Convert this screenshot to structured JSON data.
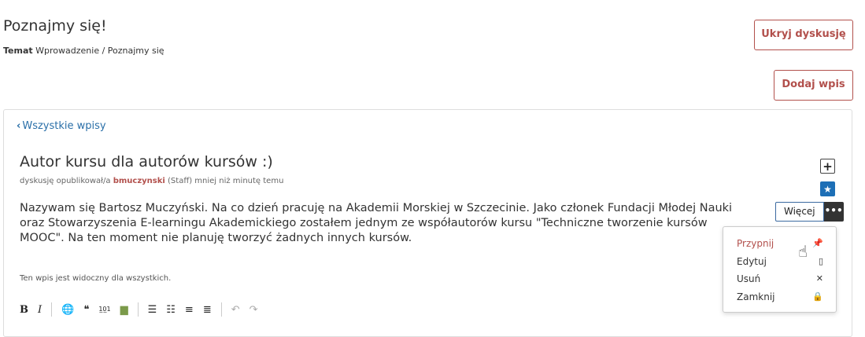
{
  "header": {
    "title": "Poznajmy się!",
    "topic_label": "Temat",
    "topic_path": "Wprowadzenie / Poznajmy się",
    "hide_button": "Ukryj dyskusję",
    "add_button": "Dodaj wpis"
  },
  "thread": {
    "back_link": "Wszystkie wpisy",
    "title": "Autor kursu dla autorów kursów :)",
    "meta_prefix": "dyskusję opublikował/a",
    "author": "bmuczynski",
    "meta_suffix": "(Staff) mniej niż minutę temu",
    "body": "Nazywam się Bartosz Muczyński. Na co dzień pracuję na Akademii Morskiej w Szczecinie. Jako członek Fundacji Młodej Nauki oraz Stowarzyszenia E-learningu Akademickiego zostałem jednym ze współautorów kursu \"Techniczne tworzenie kursów MOOC\". Na ten moment nie planuję tworzyć żadnych innych kursów.",
    "visibility": "Ten wpis jest widoczny dla wszystkich."
  },
  "actions": {
    "more_label": "Więcej",
    "menu": [
      {
        "label": "Przypnij",
        "icon": "pin-icon"
      },
      {
        "label": "Edytuj",
        "icon": "edit-icon"
      },
      {
        "label": "Usuń",
        "icon": "close-icon"
      },
      {
        "label": "Zamknij",
        "icon": "lock-icon"
      }
    ]
  },
  "colors": {
    "accent": "#b2504c",
    "link": "#2a6fa8",
    "star": "#1d6fb6"
  }
}
